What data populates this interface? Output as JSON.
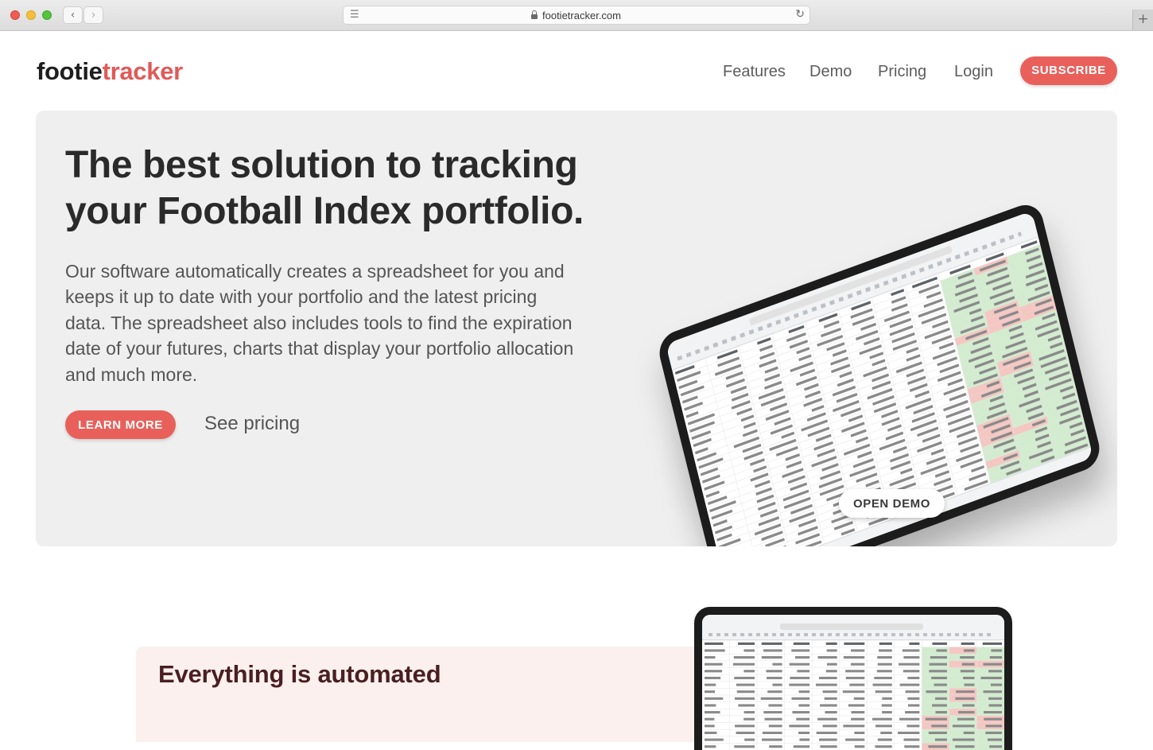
{
  "browser": {
    "url": "footietracker.com"
  },
  "header": {
    "logo_part1": "footie",
    "logo_part2": "tracker",
    "nav": {
      "features": "Features",
      "demo": "Demo",
      "pricing": "Pricing",
      "login": "Login"
    },
    "subscribe_label": "SUBSCRIBE"
  },
  "hero": {
    "title": "The best solution to tracking your Football Index portfolio.",
    "body": "Our software automatically creates a spreadsheet for you and keeps it up to date with your portfolio and the latest pricing data. The spreadsheet also includes tools to find the expiration date of your futures, charts that display your portfolio allocation and much more.",
    "learn_more_label": "LEARN MORE",
    "see_pricing_label": "See pricing",
    "open_demo_label": "OPEN DEMO"
  },
  "section2": {
    "title": "Everything is automated"
  },
  "colors": {
    "accent": "#e9605b",
    "hero_bg": "#efefef",
    "dark_text": "#2a2a2a"
  }
}
